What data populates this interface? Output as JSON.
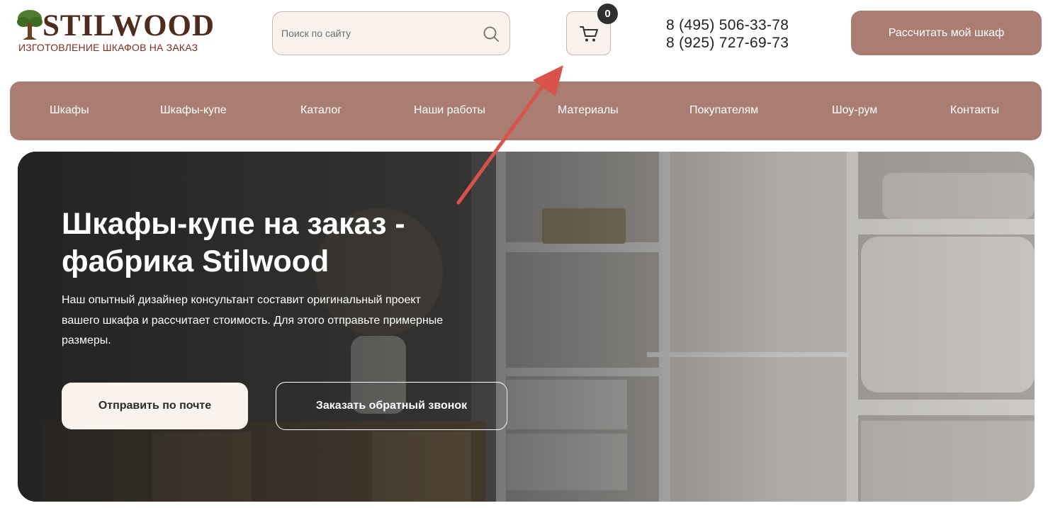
{
  "header": {
    "logo": {
      "title": "STILWOOD",
      "subtitle": "ИЗГОТОВЛЕНИЕ ШКАФОВ НА ЗАКАЗ"
    },
    "search": {
      "placeholder": "Поиск по сайту",
      "value": "",
      "icon": "search-icon"
    },
    "cart": {
      "icon": "cart-icon",
      "count": "0"
    },
    "phones": [
      "8 (495) 506-33-78",
      "8 (925) 727-69-73"
    ],
    "calc_button": "Рассчитать мой шкаф"
  },
  "nav": {
    "items": [
      "Шкафы",
      "Шкафы-купе",
      "Каталог",
      "Наши работы",
      "Материалы",
      "Покупателям",
      "Шоу-рум",
      "Контакты"
    ]
  },
  "hero": {
    "title": "Шкафы-купе на заказ - фабрика Stilwood",
    "text": "Наш опытный дизайнер консультант составит оригинальный проект вашего шкафа и рассчитает стоимость. Для этого отправьте примерные размеры.",
    "button_mail": "Отправить по почте",
    "button_call": "Заказать обратный звонок"
  },
  "colors": {
    "accent": "#a97d72",
    "light_bg": "#faf2ec",
    "logo_brown": "#4e2c1d",
    "annotation_arrow": "#d9534a"
  }
}
